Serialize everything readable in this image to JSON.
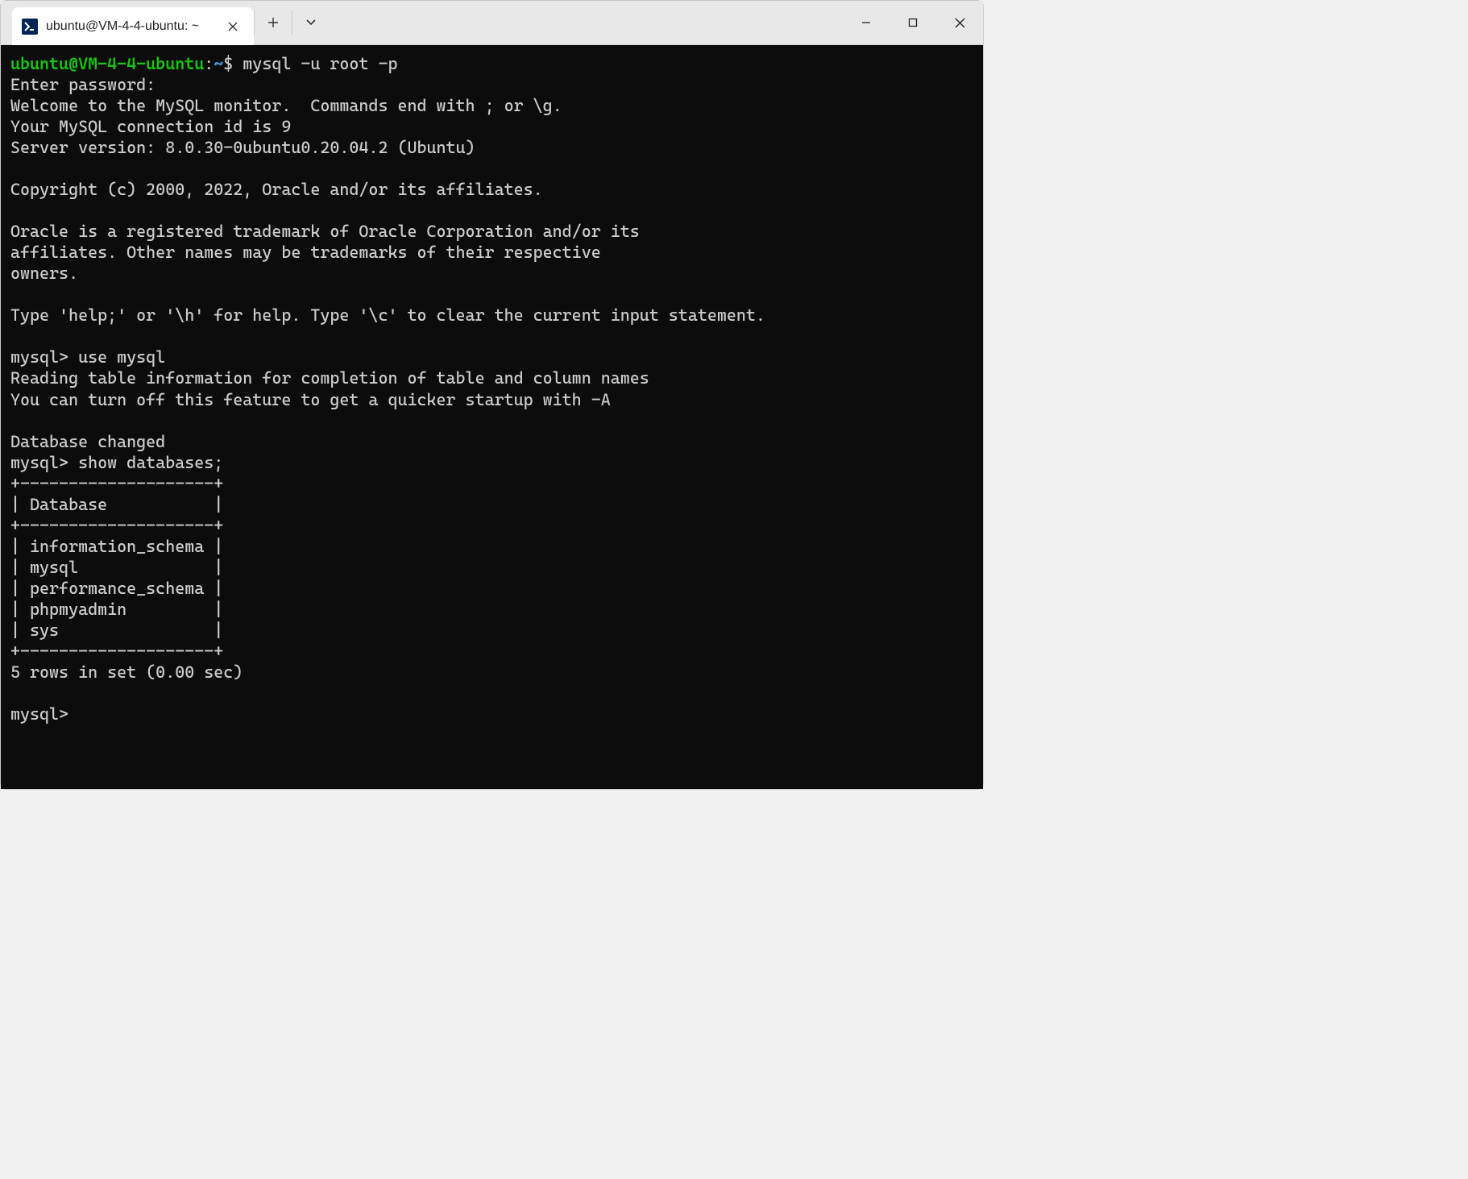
{
  "tab": {
    "title": "ubuntu@VM-4-4-ubuntu: ~",
    "icon_glyph": ">_"
  },
  "prompt": {
    "user_host": "ubuntu@VM-4-4-ubuntu",
    "sep": ":",
    "path": "~",
    "symbol": "$"
  },
  "commands": {
    "mysql_login": "mysql -u root -p",
    "use_mysql": "use mysql",
    "show_databases": "show databases;"
  },
  "mysql_prompt": "mysql>",
  "banner": {
    "enter_password": "Enter password:",
    "welcome": "Welcome to the MySQL monitor.  Commands end with ; or \\g.",
    "conn_id": "Your MySQL connection id is 9",
    "server_version": "Server version: 8.0.30-0ubuntu0.20.04.2 (Ubuntu)",
    "copyright": "Copyright (c) 2000, 2022, Oracle and/or its affiliates.",
    "trademark1": "Oracle is a registered trademark of Oracle Corporation and/or its",
    "trademark2": "affiliates. Other names may be trademarks of their respective",
    "trademark3": "owners.",
    "help_line": "Type 'help;' or '\\h' for help. Type '\\c' to clear the current input statement."
  },
  "use_output": {
    "reading": "Reading table information for completion of table and column names",
    "turn_off": "You can turn off this feature to get a quicker startup with -A",
    "changed": "Database changed"
  },
  "dbtable": {
    "border": "+--------------------+",
    "header": "| Database           |",
    "rows": [
      "| information_schema |",
      "| mysql              |",
      "| performance_schema |",
      "| phpmyadmin         |",
      "| sys                |"
    ],
    "footer": "5 rows in set (0.00 sec)"
  },
  "databases_list": [
    "information_schema",
    "mysql",
    "performance_schema",
    "phpmyadmin",
    "sys"
  ]
}
